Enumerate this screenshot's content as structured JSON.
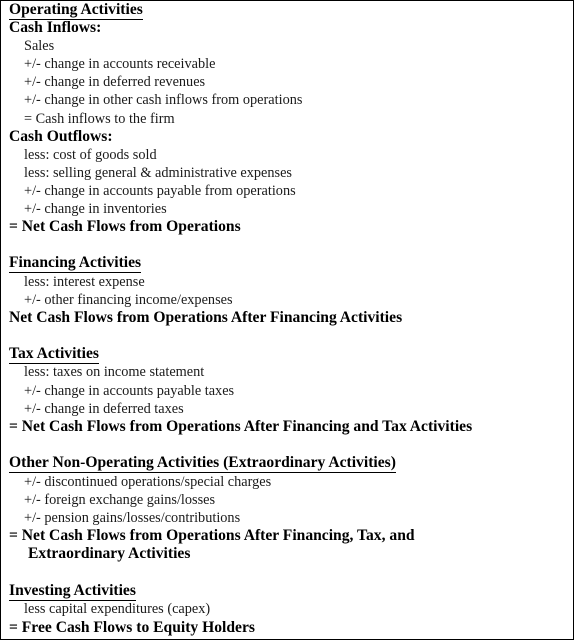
{
  "operating": {
    "heading": "Operating Activities",
    "inflows_label": "Cash Inflows:",
    "inflows": [
      "Sales",
      "+/- change in accounts receivable",
      "+/- change in deferred revenues",
      "+/- change in other cash inflows from operations",
      "= Cash inflows to the firm"
    ],
    "outflows_label": "Cash Outflows:",
    "outflows": [
      "less: cost of goods sold",
      "less: selling general & administrative expenses",
      "+/- change in accounts payable from operations",
      "+/- change in inventories"
    ],
    "total": "= Net Cash Flows from Operations"
  },
  "financing": {
    "heading": "Financing Activities",
    "items": [
      "less: interest expense",
      "+/- other financing income/expenses"
    ],
    "total": "Net Cash Flows from Operations After Financing Activities"
  },
  "tax": {
    "heading": "Tax Activities",
    "items": [
      "less: taxes on income statement",
      "+/- change in accounts payable taxes",
      "+/- change in deferred taxes"
    ],
    "total": "= Net Cash Flows from Operations After Financing and Tax Activities"
  },
  "other": {
    "heading": "Other Non-Operating Activities (Extraordinary Activities)",
    "items": [
      "+/- discontinued operations/special charges",
      "+/- foreign exchange gains/losses",
      "+/- pension gains/losses/contributions"
    ],
    "total_line1": "= Net Cash Flows from Operations After Financing, Tax, and",
    "total_line2": "Extraordinary Activities"
  },
  "investing": {
    "heading": "Investing Activities",
    "items": [
      "less capital expenditures (capex)"
    ],
    "total": "= Free Cash Flows to Equity Holders"
  }
}
